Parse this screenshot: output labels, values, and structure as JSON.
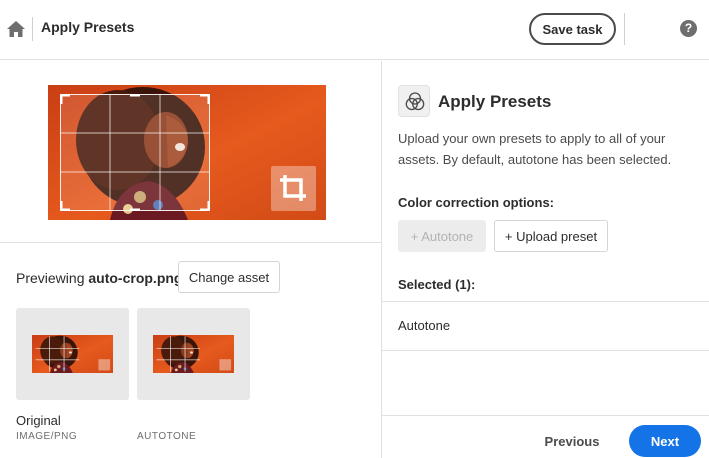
{
  "header": {
    "title": "Apply Presets",
    "save_label": "Save task",
    "help_glyph": "?"
  },
  "preview": {
    "label_prefix": "Previewing ",
    "filename": "auto-crop.png",
    "change_asset_label": "Change asset"
  },
  "thumbnails": [
    {
      "title": "Original",
      "subtitle": "IMAGE/PNG"
    },
    {
      "title": "",
      "subtitle": "AUTOTONE"
    }
  ],
  "panel": {
    "title": "Apply Presets",
    "description": "Upload your own presets to apply to all of your assets. By default, autotone has been selected.",
    "options_label": "Color correction options:",
    "autotone_button": "+ Autotone",
    "upload_button": "+ Upload preset",
    "selected_label": "Selected (1):",
    "selected_items": [
      "Autotone"
    ]
  },
  "footer": {
    "previous_label": "Previous",
    "next_label": "Next"
  },
  "icons": {
    "home": "home-icon",
    "help": "help-icon",
    "crop": "crop-icon",
    "preset": "color-circles-icon"
  },
  "colors": {
    "accent": "#1473e6",
    "photo_orange": "#e0541c"
  }
}
